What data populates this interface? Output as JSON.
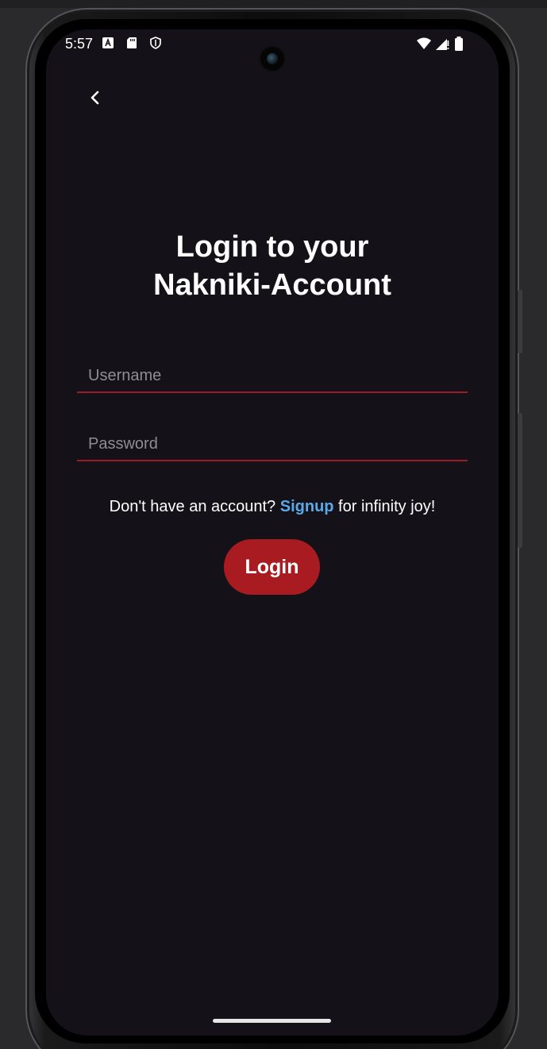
{
  "status_bar": {
    "time": "5:57",
    "left_icons": [
      "accessibility-a-icon",
      "sd-card-icon",
      "shield-icon"
    ],
    "right_icons": [
      "wifi-icon",
      "cellular-signal-icon",
      "battery-icon"
    ]
  },
  "nav": {
    "back_icon": "chevron-left-icon"
  },
  "login": {
    "title_line1": "Login to your",
    "title_line2": "Nakniki-Account",
    "username_placeholder": "Username",
    "password_placeholder": "Password",
    "signup_prefix": "Don't have an account? ",
    "signup_link": "Signup",
    "signup_suffix": " for infinity joy!",
    "login_button": "Login"
  },
  "colors": {
    "background": "#141218",
    "accent": "#a81c21",
    "field_underline": "#9c1c24",
    "link": "#5ba9e8",
    "placeholder": "#8f8c96"
  }
}
